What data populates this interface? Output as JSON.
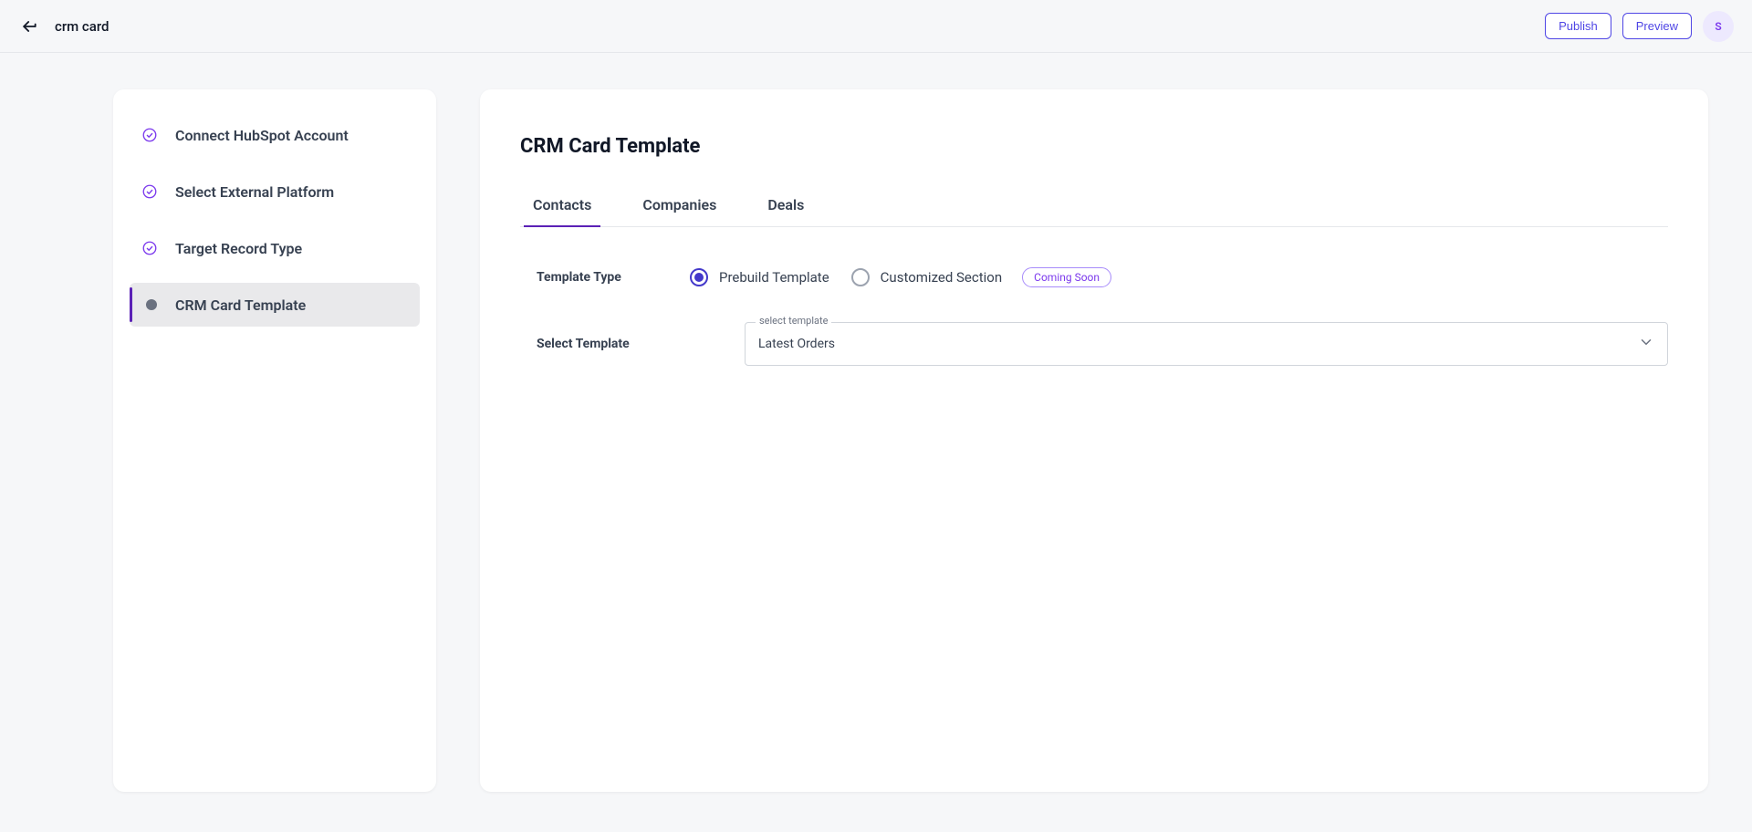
{
  "header": {
    "title": "crm card",
    "publish_label": "Publish",
    "preview_label": "Preview",
    "avatar_initial": "S"
  },
  "sidebar": {
    "items": [
      {
        "label": "Connect HubSpot Account",
        "state": "done"
      },
      {
        "label": "Select External Platform",
        "state": "done"
      },
      {
        "label": "Target Record Type",
        "state": "done"
      },
      {
        "label": "CRM Card Template",
        "state": "active"
      }
    ]
  },
  "main": {
    "title": "CRM Card Template",
    "tabs": [
      {
        "label": "Contacts",
        "active": true
      },
      {
        "label": "Companies",
        "active": false
      },
      {
        "label": "Deals",
        "active": false
      }
    ],
    "template_type": {
      "label": "Template Type",
      "options": [
        {
          "label": "Prebuild Template",
          "selected": true,
          "badge": null
        },
        {
          "label": "Customized Section",
          "selected": false,
          "badge": "Coming Soon"
        }
      ]
    },
    "select_template": {
      "label": "Select Template",
      "floating_label": "select template",
      "value": "Latest Orders"
    }
  }
}
